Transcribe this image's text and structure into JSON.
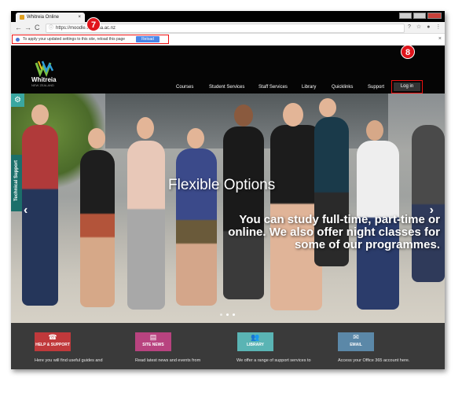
{
  "browser": {
    "tab_title": "Whitreia Online",
    "tab_close": "×",
    "url": "https://moodle.whitreia.ac.nz",
    "nav": {
      "back": "←",
      "forward": "→",
      "reload": "C"
    },
    "addr_icons": [
      "?",
      "☆",
      "●",
      "⋮"
    ],
    "infobar": {
      "message": "To apply your updated settings to this site, reload this page",
      "reload_label": "Reload",
      "close": "×"
    }
  },
  "callouts": {
    "seven": "7",
    "eight": "8"
  },
  "site": {
    "logo_text": "Whitreia",
    "logo_sub": "NEW ZEALAND",
    "nav": [
      "Courses",
      "Student Services",
      "Staff Services",
      "Library",
      "Quicklinks",
      "Support"
    ],
    "login_label": "Log in"
  },
  "hero": {
    "title": "Flexible Options",
    "text": "You can study full-time, part-time or online. We also offer night classes for some of our programmes.",
    "prev": "‹",
    "next": "›",
    "tech_support_label": "Technical Support",
    "gear": "⚙"
  },
  "footer": {
    "boxes": [
      {
        "label": "HELP & SUPPORT",
        "icon": "☎",
        "color": "#c0393b",
        "desc": "Here you will find useful guides and"
      },
      {
        "label": "SITE NEWS",
        "icon": "▤",
        "color": "#b8437f",
        "desc": "Read latest news and events from"
      },
      {
        "label": "LIBRARY",
        "icon": "👥",
        "color": "#5ab4b4",
        "desc": "We offer a range of support services to"
      },
      {
        "label": "EMAIL",
        "icon": "✉",
        "color": "#5b88a8",
        "desc": "Access your Office 365 account here."
      }
    ]
  }
}
